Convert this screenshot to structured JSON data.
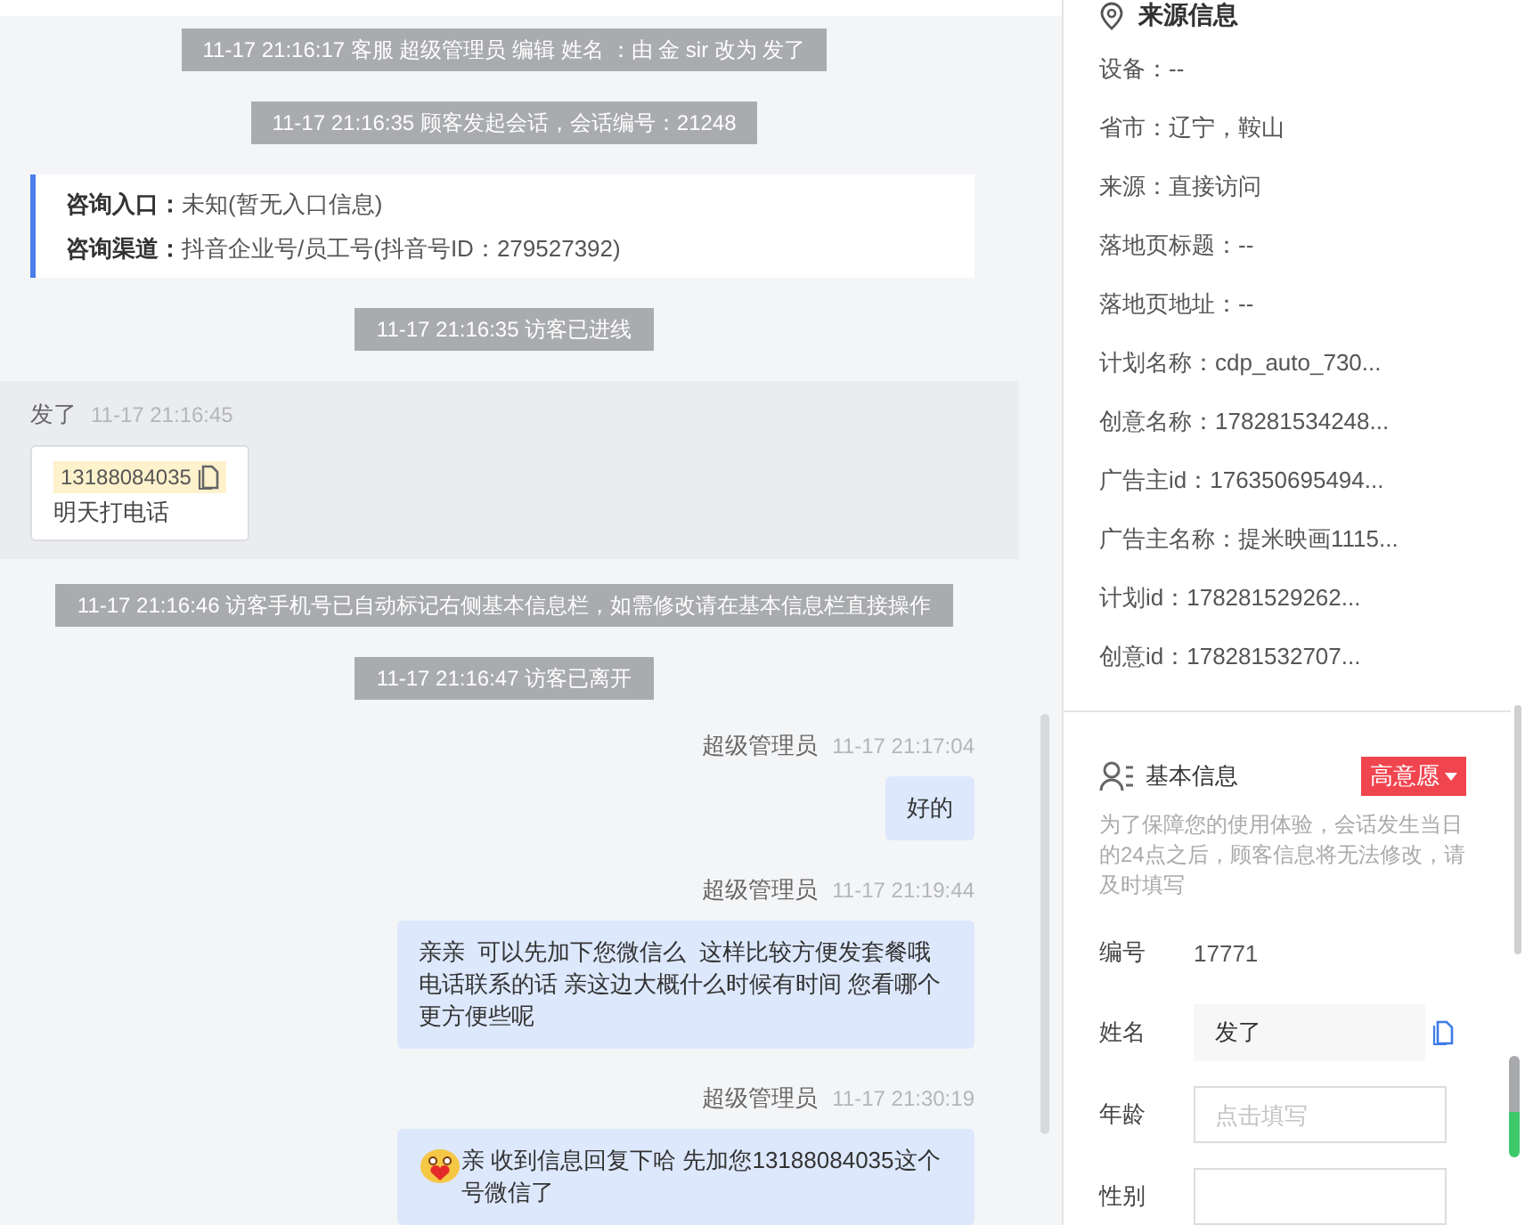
{
  "chat": {
    "messages": [
      {
        "kind": "system",
        "text": "11-17 21:16:17 客服 超级管理员 编辑 姓名 ：由 金 sir 改为 发了"
      },
      {
        "kind": "system",
        "text": "11-17 21:16:35 顾客发起会话，会话编号：21248"
      },
      {
        "kind": "entry",
        "lines": [
          "**咨询入口：**未知(暂无入口信息)",
          "**咨询渠道：**抖音企业号/员工号(抖音号ID：279527392)"
        ]
      },
      {
        "kind": "system",
        "text": "11-17 21:16:35 访客已进线"
      },
      {
        "kind": "visitor",
        "sender": "发了",
        "time": "11-17 21:16:45",
        "phone": "13188084035",
        "text": "明天打电话"
      },
      {
        "kind": "system",
        "text": "11-17 21:16:46 访客手机号已自动标记右侧基本信息栏，如需修改请在基本信息栏直接操作"
      },
      {
        "kind": "system",
        "text": "11-17 21:16:47 访客已离开"
      },
      {
        "kind": "agent",
        "sender": "超级管理员",
        "time": "11-17 21:17:04",
        "text": "好的"
      },
      {
        "kind": "agent",
        "sender": "超级管理员",
        "time": "11-17 21:19:44",
        "text": "亲亲  可以先加下您微信么  这样比较方便发套餐哦电话联系的话 亲这边大概什么时候有时间 您看哪个更方便些呢"
      },
      {
        "kind": "agent",
        "sender": "超级管理员",
        "time": "11-17 21:30:19",
        "text": "亲 收到信息回复下哈 先加您13188084035这个号微信了",
        "sticker": true
      }
    ]
  },
  "source_info": {
    "title": "来源信息",
    "rows": [
      "设备：--",
      "省市：辽宁，鞍山",
      "来源：直接访问",
      "落地页标题：--",
      "落地页地址：--",
      "计划名称：cdp_auto_730...",
      "创意名称：178281534248...",
      "广告主id：176350695494...",
      "广告主名称：提米映画1115...",
      "计划id：178281529262...",
      "创意id：178281532707..."
    ]
  },
  "basic_info": {
    "title": "基本信息",
    "intent_tag": "高意愿",
    "note": "为了保障您的使用体验，会话发生当日的24点之后，顾客信息将无法修改，请及时填写",
    "fields": [
      {
        "label": "编号",
        "kind": "text",
        "value": "17771"
      },
      {
        "label": "姓名",
        "kind": "filled",
        "value": "发了",
        "copyable": true
      },
      {
        "label": "年龄",
        "kind": "input",
        "placeholder": "点击填写"
      },
      {
        "label": "性别",
        "kind": "input"
      }
    ]
  }
}
